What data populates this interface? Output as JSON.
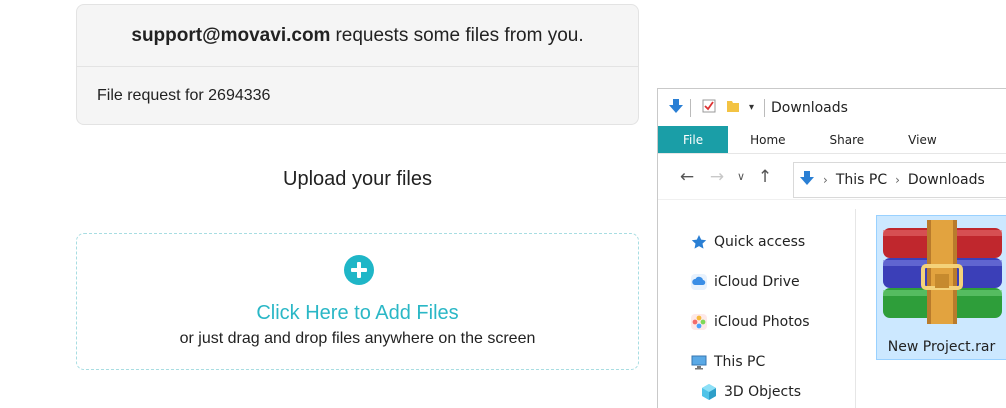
{
  "request": {
    "email": "support@movavi.com",
    "text": "requests some files from you.",
    "file_request": "File request for 2694336"
  },
  "upload": {
    "title": "Upload your files",
    "add_files": "Click Here to Add Files",
    "drag_hint": "or just drag and drop files anywhere on the screen"
  },
  "explorer": {
    "title": "Downloads",
    "tabs": [
      "File",
      "Home",
      "Share",
      "View"
    ],
    "breadcrumb": [
      "This PC",
      "Downloads"
    ],
    "nav_items": [
      "Quick access",
      "iCloud Drive",
      "iCloud Photos",
      "This PC",
      "3D Objects"
    ],
    "file_name": "New Project.rar"
  },
  "colors": {
    "accent": "#2ab7c6",
    "ribbon_file": "#1a9ea7",
    "selection": "#cce8ff"
  }
}
